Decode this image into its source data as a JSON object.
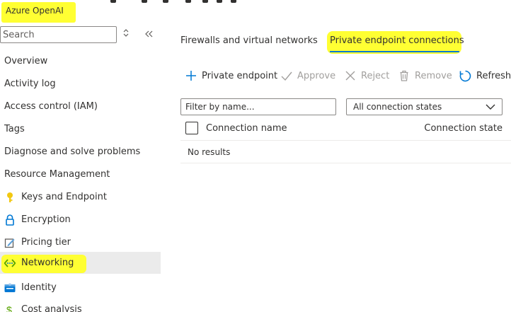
{
  "resource_name": "Azure OpenAI",
  "sidebar": {
    "search_placeholder": "Search",
    "items": [
      {
        "label": "Overview"
      },
      {
        "label": "Activity log"
      },
      {
        "label": "Access control (IAM)"
      },
      {
        "label": "Tags"
      },
      {
        "label": "Diagnose and solve problems"
      }
    ],
    "section_header": "Resource Management",
    "section_items": [
      {
        "label": "Keys and Endpoint",
        "icon": "key-icon"
      },
      {
        "label": "Encryption",
        "icon": "lock-icon"
      },
      {
        "label": "Pricing tier",
        "icon": "edit-icon"
      },
      {
        "label": "Networking",
        "icon": "networking-icon",
        "selected": true
      },
      {
        "label": "Identity",
        "icon": "identity-icon"
      },
      {
        "label": "Cost analysis",
        "icon": "cost-icon"
      }
    ]
  },
  "tabs": [
    {
      "label": "Firewalls and virtual networks"
    },
    {
      "label": "Private endpoint connections",
      "active": true
    }
  ],
  "toolbar": {
    "private_endpoint": "Private endpoint",
    "approve": "Approve",
    "reject": "Reject",
    "remove": "Remove",
    "refresh": "Refresh"
  },
  "filter": {
    "placeholder": "Filter by name...",
    "state_value": "All connection states"
  },
  "grid": {
    "col_name": "Connection name",
    "col_state": "Connection state",
    "empty_text": "No results"
  },
  "colors": {
    "highlight": "#ffff33",
    "accent": "#0078d4"
  }
}
